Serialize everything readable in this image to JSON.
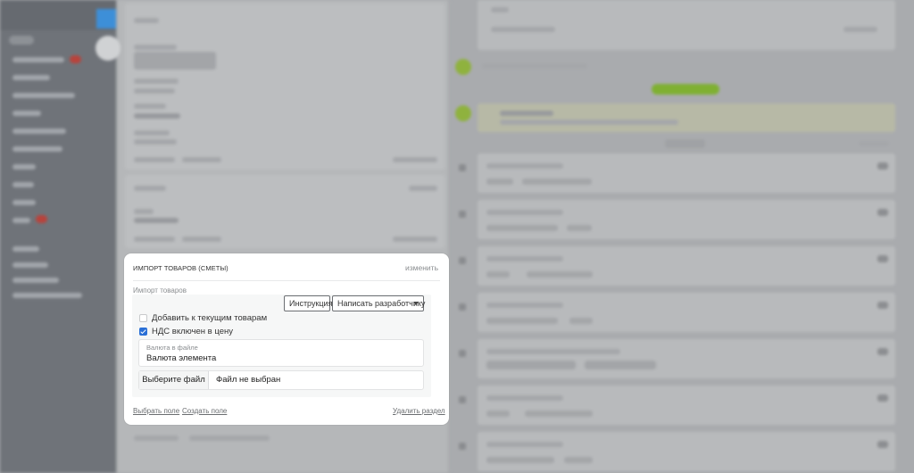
{
  "section": {
    "title": "ИМПОРТ ТОВАРОВ (СМЕТЫ)",
    "edit_label": "изменить",
    "field_label": "Импорт товаров"
  },
  "toolbar": {
    "instruction_label": "Инструкция",
    "write_dev_label": "Написать разработчику"
  },
  "options": {
    "add_to_current": {
      "label": "Добавить к текущим товарам",
      "checked": false
    },
    "vat_included": {
      "label": "НДС включен в цену",
      "checked": true
    }
  },
  "currency": {
    "label": "Валюта в файле",
    "value": "Валюта элемента"
  },
  "file": {
    "button_label": "Выберите файл",
    "status": "Файл не выбран"
  },
  "footer": {
    "select_field": "Выбрать поле",
    "create_field": "Создать поле",
    "delete_section": "Удалить раздел"
  },
  "colors": {
    "accent_blue": "#2a6fd6",
    "overlay": "#a9abae",
    "success_green": "#7fb032"
  }
}
